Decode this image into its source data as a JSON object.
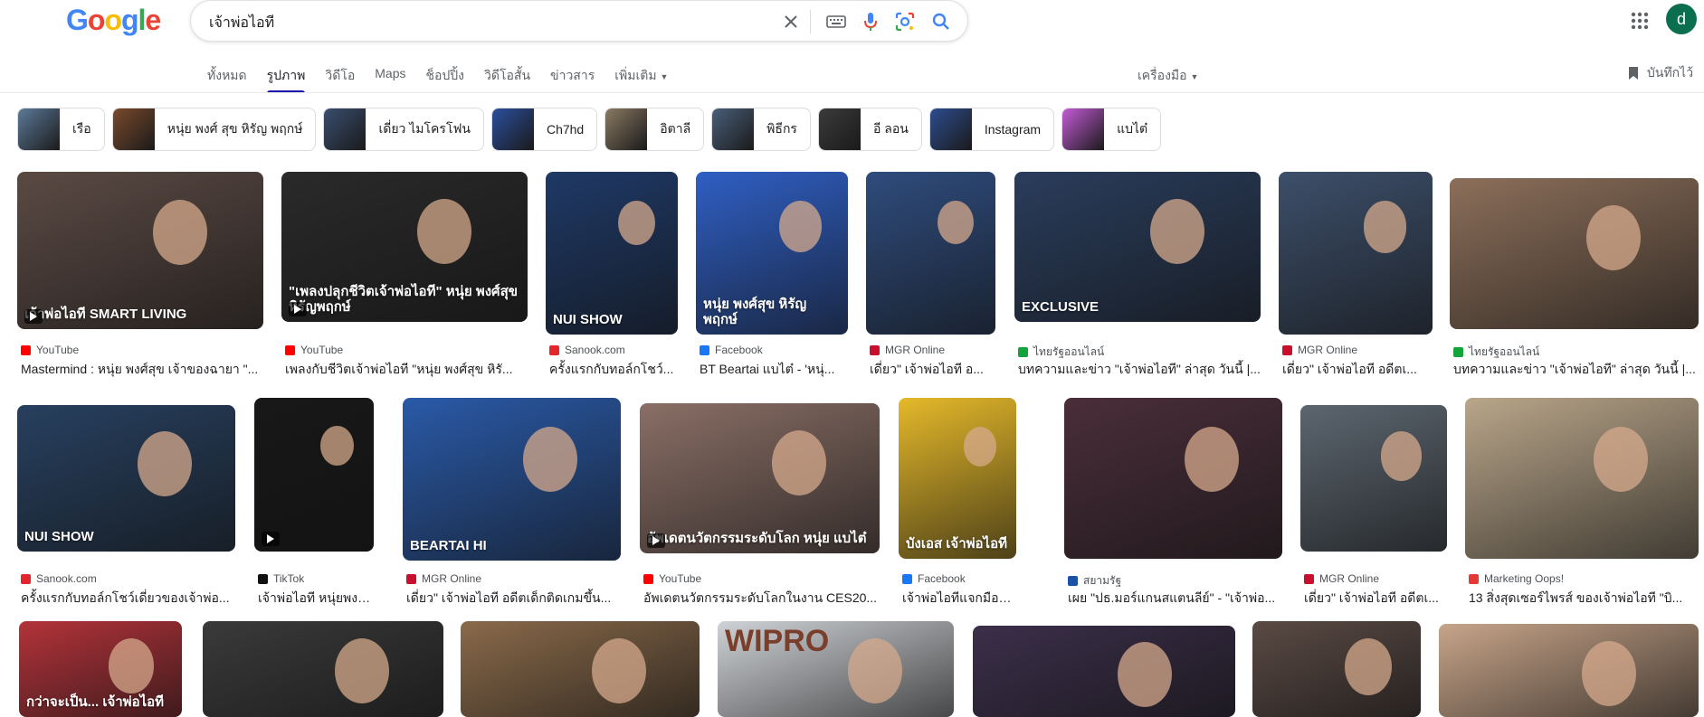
{
  "search": {
    "query": "เจ้าพ่อไอที",
    "logo": "Google"
  },
  "user": {
    "avatar_letter": "d"
  },
  "tabs": [
    {
      "label": "ทั้งหมด",
      "active": false
    },
    {
      "label": "รูปภาพ",
      "active": true
    },
    {
      "label": "วิดีโอ",
      "active": false
    },
    {
      "label": "Maps",
      "active": false
    },
    {
      "label": "ช็อปปิ้ง",
      "active": false
    },
    {
      "label": "วิดีโอสั้น",
      "active": false
    },
    {
      "label": "ข่าวสาร",
      "active": false
    },
    {
      "label": "เพิ่มเติม",
      "active": false
    }
  ],
  "tools_label": "เครื่องมือ",
  "saved_label": "บันทึกไว้",
  "chips": [
    {
      "label": "เรือ",
      "color": "#5c7a99"
    },
    {
      "label": "หนุ่ย พงศ์ สุข หิรัญ พฤกษ์",
      "color": "#7b4a2c"
    },
    {
      "label": "เดี่ยว ไมโครโฟน",
      "color": "#3a4e6f"
    },
    {
      "label": "Ch7hd",
      "color": "#2b4f9e"
    },
    {
      "label": "อิตาลี",
      "color": "#8a7a62"
    },
    {
      "label": "พิธีกร",
      "color": "#4a5f7a"
    },
    {
      "label": "อี ลอน",
      "color": "#3b3b3b"
    },
    {
      "label": "Instagram",
      "color": "#2d4d8f"
    },
    {
      "label": "แบไต๋",
      "color": "#c45bd6"
    }
  ],
  "results": [
    {
      "source": "YouTube",
      "title": "Mastermind : หนุ่ย พงศ์สุข เจ้าของฉายา \"...",
      "fav": "#ff0000",
      "bg": "#5b4a44",
      "overlay": "เจ้าพ่อไอที SMART LIVING",
      "video": true
    },
    {
      "source": "YouTube",
      "title": "เพลงกับชีวิตเจ้าพ่อไอที \"หนุ่ย พงศ์สุข หิรั...",
      "fav": "#ff0000",
      "bg": "#2a2a2a",
      "overlay": "\"เพลงปลุกชีวิตเจ้าพ่อไอที\" หนุ่ย พงศ์สุข หิรัญพฤกษ์",
      "video": true
    },
    {
      "source": "Sanook.com",
      "title": "ครั้งแรกกับทอล์กโชว์...",
      "fav": "#e3262b",
      "bg": "#1f3966",
      "overlay": "NUI SHOW",
      "video": false
    },
    {
      "source": "Facebook",
      "title": "BT Beartai แบไต๋ - 'หนุ่...",
      "fav": "#1877f2",
      "bg": "#2f5fc4",
      "overlay": "หนุ่ย พงศ์สุข หิรัญพฤกษ์",
      "video": false
    },
    {
      "source": "MGR Online",
      "title": "เดี่ยว\" เจ้าพ่อไอที อ...",
      "fav": "#c8102e",
      "bg": "#2f4c7d",
      "overlay": "",
      "video": false
    },
    {
      "source": "ไทยรัฐออนไลน์",
      "title": "บทความและข่าว \"เจ้าพ่อไอที\" ล่าสุด วันนี้ |...",
      "fav": "#15a33b",
      "bg": "#2a3d5c",
      "overlay": "EXCLUSIVE",
      "video": false
    },
    {
      "source": "MGR Online",
      "title": "เดี่ยว\" เจ้าพ่อไอที อดีตเ...",
      "fav": "#c8102e",
      "bg": "#3d4f6a",
      "overlay": "",
      "video": false
    },
    {
      "source": "ไทยรัฐออนไลน์",
      "title": "บทความและข่าว \"เจ้าพ่อไอที\" ล่าสุด วันนี้ |...",
      "fav": "#15a33b",
      "bg": "#8c6f5a",
      "overlay": "",
      "video": false
    },
    {
      "source": "Sanook.com",
      "title": "ครั้งแรกกับทอล์กโชว์เดี่ยวของเจ้าพ่อ...",
      "fav": "#e3262b",
      "bg": "#27405f",
      "overlay": "NUI SHOW",
      "video": false
    },
    {
      "source": "TikTok",
      "title": "เจ้าพ่อไอที หนุ่ยพงศ์...",
      "fav": "#111111",
      "bg": "#181818",
      "overlay": "",
      "video": true
    },
    {
      "source": "MGR Online",
      "title": "เดี่ยว\" เจ้าพ่อไอที อดีตเด็กติดเกมขึ้น...",
      "fav": "#c8102e",
      "bg": "#2a5aa8",
      "overlay": "BEARTAI HI",
      "video": false
    },
    {
      "source": "YouTube",
      "title": "อัพเดตนวัตกรรมระดับโลกในงาน CES20...",
      "fav": "#ff0000",
      "bg": "#8a6f66",
      "overlay": "อัพเดตนวัตกรรมระดับโลก หนุ่ย แบไต๋",
      "video": true
    },
    {
      "source": "Facebook",
      "title": "เจ้าพ่อไอทีแจกมือถือฟรี",
      "fav": "#1877f2",
      "bg": "#e5b92a",
      "overlay": "บังเอส เจ้าพ่อไอที",
      "video": false
    },
    {
      "source": "สยามรัฐ",
      "title": "เผย \"ปธ.มอร์แกนสแตนลีย์\" - \"เจ้าพ่อ...",
      "fav": "#1a53a6",
      "bg": "#4a2e3a",
      "overlay": "",
      "video": false
    },
    {
      "source": "MGR Online",
      "title": "เดี่ยว\" เจ้าพ่อไอที อดีตเ...",
      "fav": "#c8102e",
      "bg": "#5c6670",
      "overlay": "",
      "video": false
    },
    {
      "source": "Marketing Oops!",
      "title": "13 สิ่งสุดเซอร์ไพรส์ ของเจ้าพ่อไอที \"บิ...",
      "fav": "#e53935",
      "bg": "#b9a68a",
      "overlay": "",
      "video": false
    },
    {
      "source": "",
      "title": "",
      "fav": "#999999",
      "bg": "#b3333a",
      "overlay": "กว่าจะเป็น... เจ้าพ่อไอที",
      "video": false
    },
    {
      "source": "",
      "title": "",
      "fav": "#999999",
      "bg": "#3a3a3a",
      "overlay": "",
      "video": false
    },
    {
      "source": "",
      "title": "",
      "fav": "#999999",
      "bg": "#8a6a4a",
      "overlay": "",
      "video": false
    },
    {
      "source": "",
      "title": "",
      "fav": "#999999",
      "bg": "#cfd2d6",
      "overlay": "WIPRO",
      "video": false
    },
    {
      "source": "",
      "title": "",
      "fav": "#999999",
      "bg": "#3b2f4a",
      "overlay": "",
      "video": false
    },
    {
      "source": "",
      "title": "",
      "fav": "#999999",
      "bg": "#5a4a44",
      "overlay": "",
      "video": false
    },
    {
      "source": "",
      "title": "",
      "fav": "#999999",
      "bg": "#c7a489",
      "overlay": "",
      "video": false
    }
  ]
}
